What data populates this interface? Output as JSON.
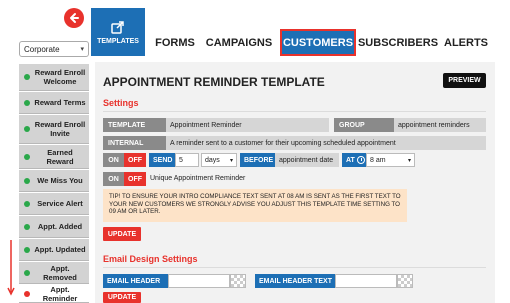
{
  "sidebar": {
    "selector": "Corporate",
    "items": [
      {
        "label": "Reward Enroll Welcome",
        "status": "green"
      },
      {
        "label": "Reward Terms",
        "status": "green"
      },
      {
        "label": "Reward Enroll Invite",
        "status": "green"
      },
      {
        "label": "Earned Reward",
        "status": "green"
      },
      {
        "label": "We Miss You",
        "status": "green"
      },
      {
        "label": "Service Alert",
        "status": "green"
      },
      {
        "label": "Appt. Added",
        "status": "green"
      },
      {
        "label": "Appt. Updated",
        "status": "green"
      },
      {
        "label": "Appt. Removed",
        "status": "green"
      },
      {
        "label": "Appt. Reminder",
        "status": "red"
      }
    ]
  },
  "tabs": {
    "templates": "TEMPLATES",
    "forms": "FORMS",
    "campaigns": "CAMPAIGNS",
    "customers": "CUSTOMERS",
    "subscribers": "SUBSCRIBERS",
    "alerts": "ALERTS"
  },
  "page": {
    "title": "APPOINTMENT REMINDER TEMPLATE",
    "preview": "PREVIEW"
  },
  "settings": {
    "heading": "Settings",
    "template_label": "TEMPLATE",
    "template_value": "Appointment Reminder",
    "group_label": "GROUP",
    "group_value": "appointment reminders",
    "internal_label": "INTERNAL",
    "internal_value": "A reminder sent to a customer for their upcoming scheduled appointment",
    "on": "ON",
    "off": "OFF",
    "send_label": "SEND",
    "send_value": "5",
    "unit_value": "days",
    "before_label": "BEFORE",
    "before_value": "appointment date",
    "at_label": "AT",
    "time_value": "8 am",
    "unique_label": "Unique Appointment Reminder",
    "tip": "TIP! TO ENSURE YOUR INTRO COMPLIANCE TEXT SENT AT 08 AM IS SENT AS THE FIRST TEXT TO YOUR NEW CUSTOMERS WE STRONGLY ADVISE YOU ADJUST THIS TEMPLATE TIME SETTING TO 09 AM OR LATER.",
    "update": "UPDATE"
  },
  "email_design": {
    "heading": "Email Design Settings",
    "email_header": "EMAIL HEADER",
    "email_header_text": "EMAIL HEADER TEXT",
    "update": "UPDATE"
  },
  "colors": {
    "accent_blue": "#1d6fb5",
    "accent_red": "#e8322c",
    "sidebar_green": "#2aa84a"
  }
}
